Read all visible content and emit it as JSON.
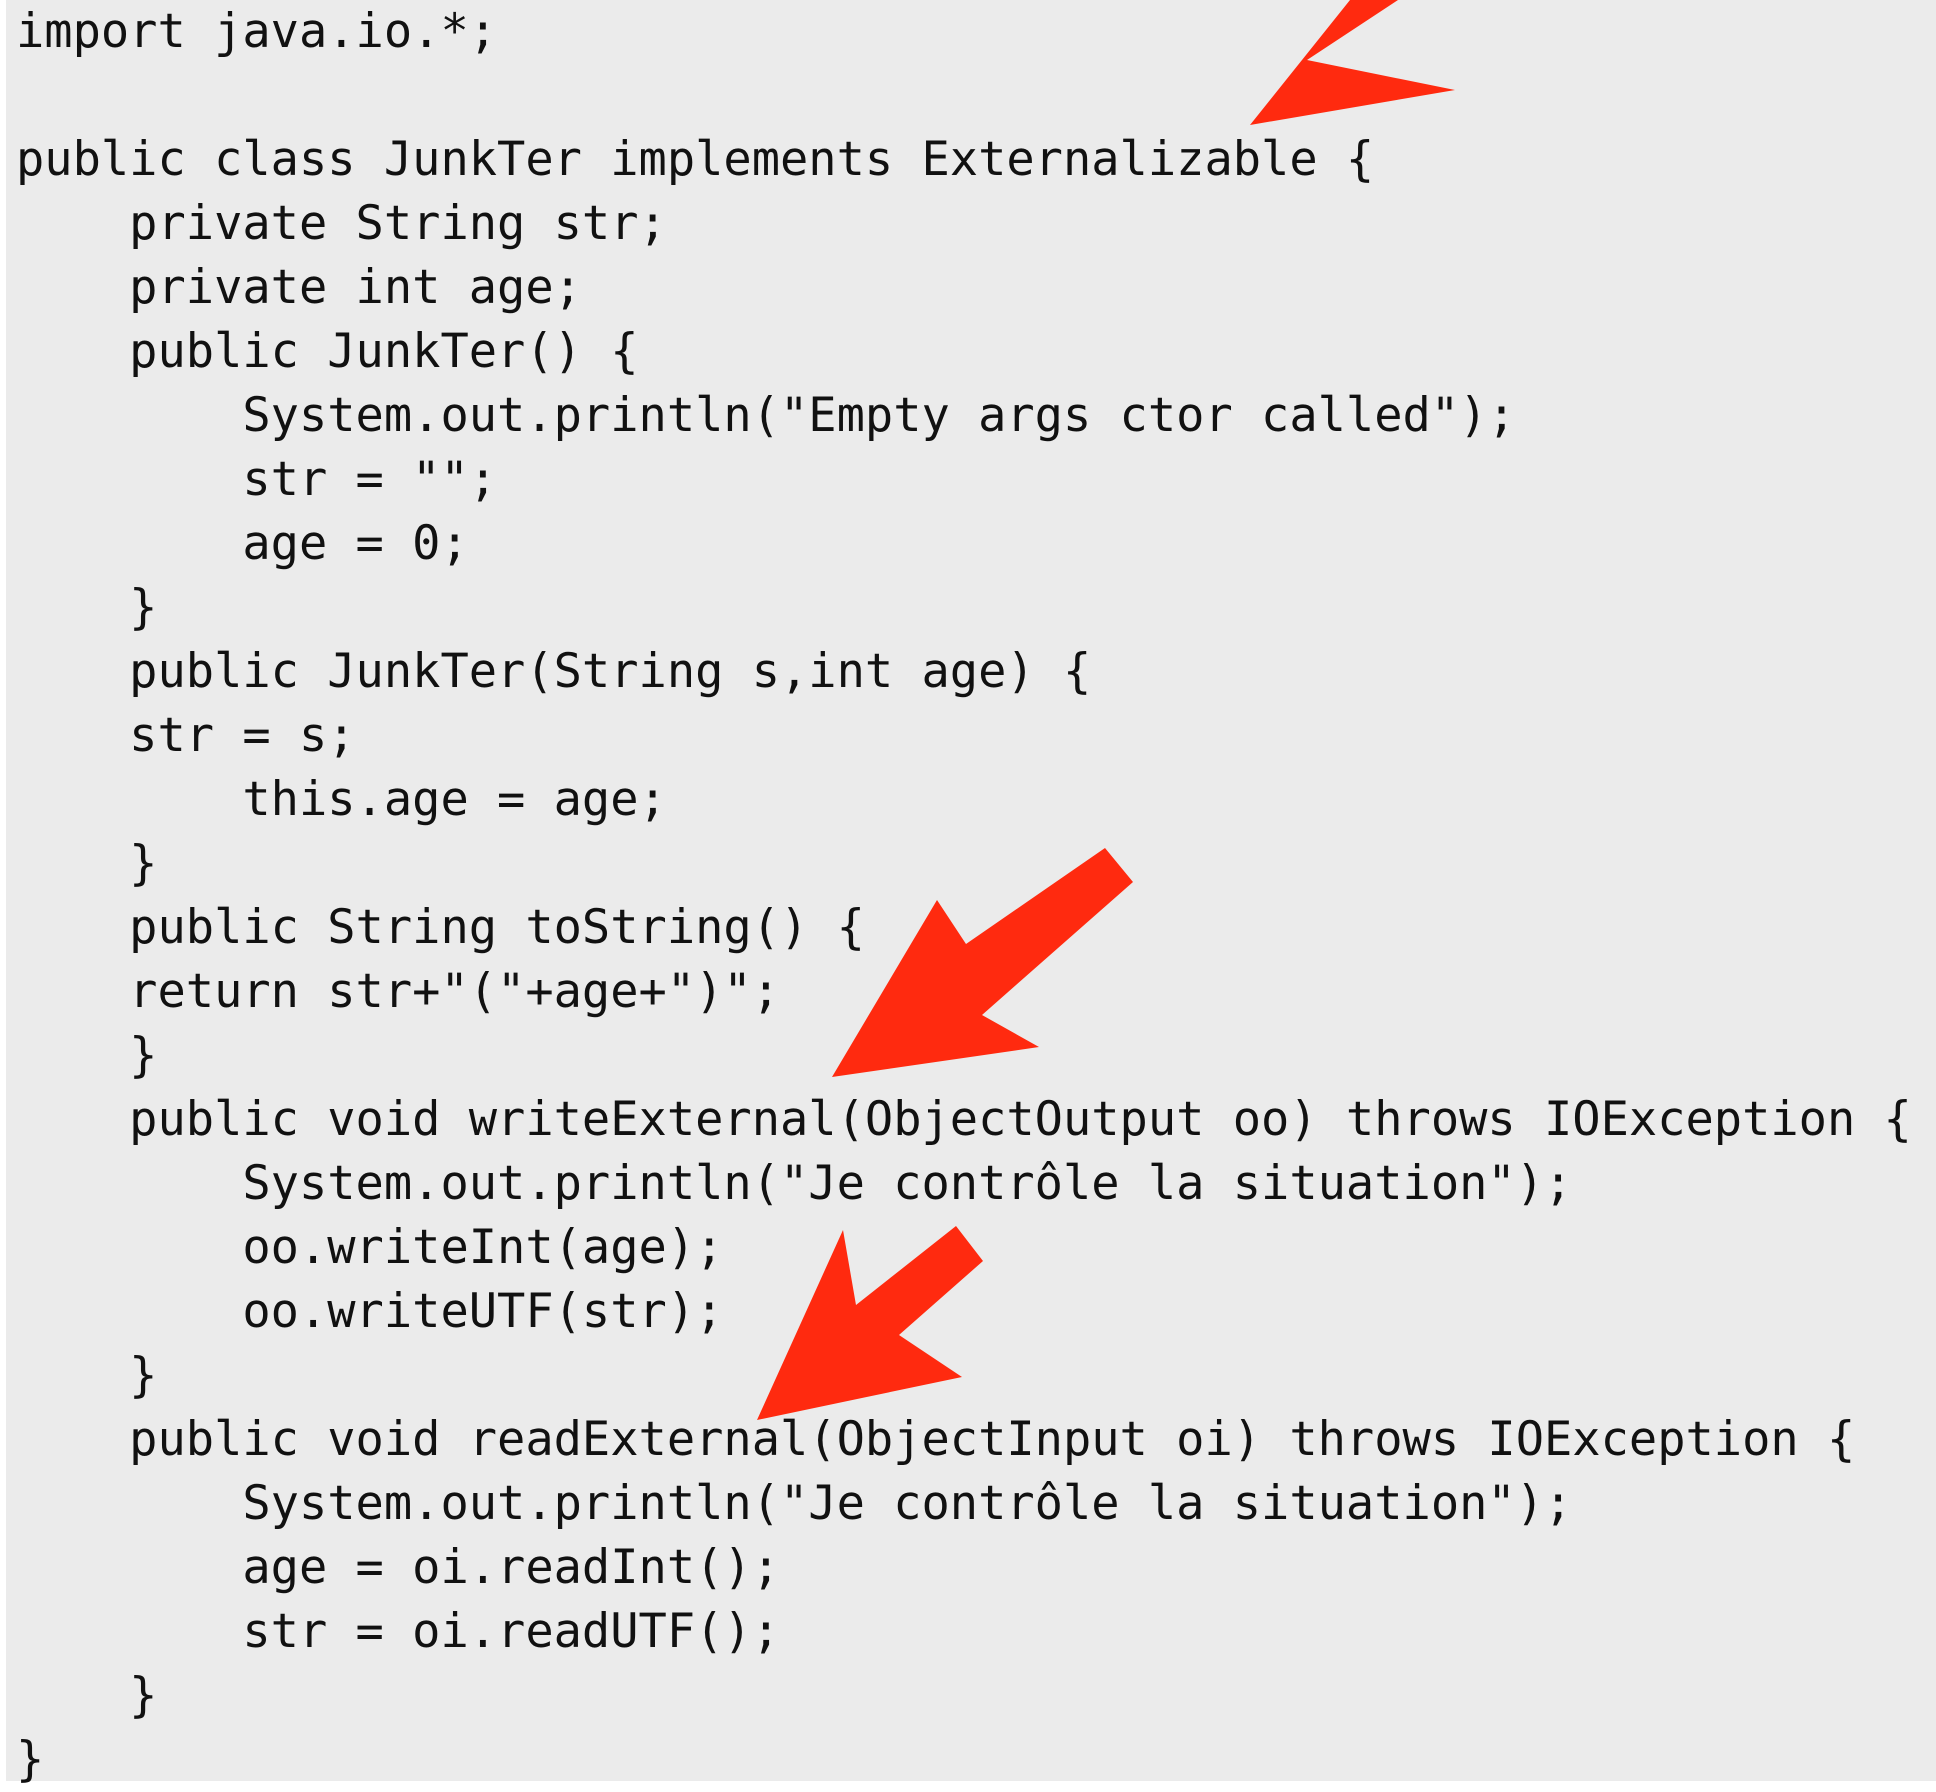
{
  "code": {
    "lines": [
      "import java.io.*;",
      "",
      "public class JunkTer implements Externalizable {",
      "    private String str;",
      "    private int age;",
      "    public JunkTer() {",
      "        System.out.println(\"Empty args ctor called\");",
      "        str = \"\";",
      "        age = 0;",
      "    }",
      "    public JunkTer(String s,int age) {",
      "    str = s;",
      "        this.age = age;",
      "    }",
      "    public String toString() {",
      "    return str+\"(\"+age+\")\";",
      "    }",
      "    public void writeExternal(ObjectOutput oo) throws IOException {",
      "        System.out.println(\"Je contrôle la situation\");",
      "        oo.writeInt(age);",
      "        oo.writeUTF(str);",
      "    }",
      "    public void readExternal(ObjectInput oi) throws IOException {",
      "        System.out.println(\"Je contrôle la situation\");",
      "        age = oi.readInt();",
      "        str = oi.readUTF();",
      "    }",
      "}"
    ]
  },
  "annotations": {
    "arrow_color": "#ff2a0f",
    "arrow_count": 3
  }
}
